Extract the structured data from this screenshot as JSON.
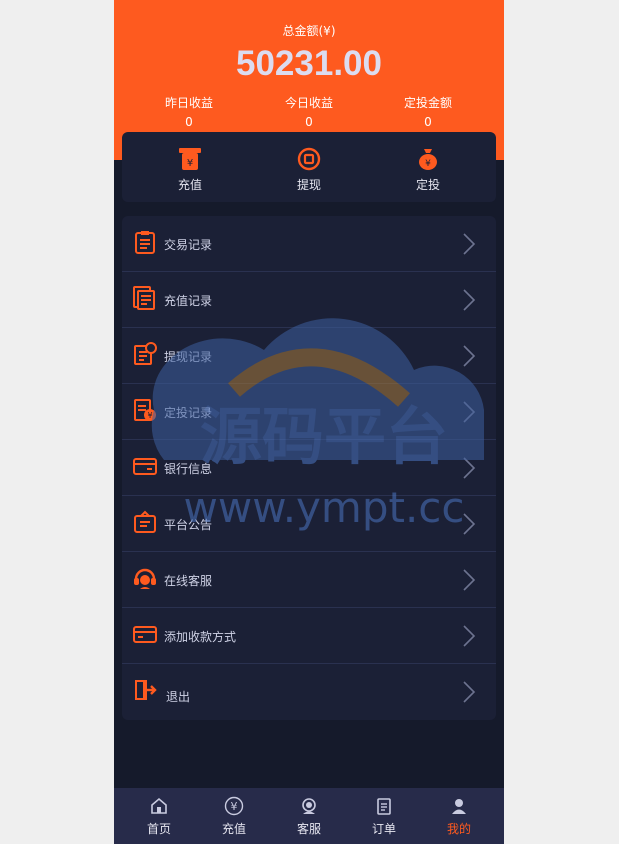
{
  "header": {
    "total_label": "总金额(¥)",
    "total_value": "50231.00",
    "stats": [
      {
        "label": "昨日收益",
        "value": "0"
      },
      {
        "label": "今日收益",
        "value": "0"
      },
      {
        "label": "定投金额",
        "value": "0"
      }
    ]
  },
  "actions": [
    {
      "label": "充值",
      "icon": "recharge-icon"
    },
    {
      "label": "提现",
      "icon": "withdraw-icon"
    },
    {
      "label": "定投",
      "icon": "moneybag-icon"
    }
  ],
  "menu": [
    {
      "label": "交易记录",
      "icon": "clipboard-icon"
    },
    {
      "label": "充值记录",
      "icon": "document-list-icon"
    },
    {
      "label": "提现记录",
      "icon": "withdraw-record-icon"
    },
    {
      "label": "定投记录",
      "icon": "invest-record-icon"
    },
    {
      "label": "银行信息",
      "icon": "bank-card-icon"
    },
    {
      "label": "平台公告",
      "icon": "announcement-icon"
    },
    {
      "label": "在线客服",
      "icon": "headset-icon"
    },
    {
      "label": "添加收款方式",
      "icon": "card-add-icon"
    },
    {
      "label": "退出",
      "icon": "logout-icon"
    }
  ],
  "watermark": {
    "title": "源码平台",
    "url": "www.ympt.cc"
  },
  "tabs": [
    {
      "label": "首页",
      "icon": "home-icon"
    },
    {
      "label": "充值",
      "icon": "yen-circle-icon"
    },
    {
      "label": "客服",
      "icon": "support-icon"
    },
    {
      "label": "订单",
      "icon": "order-icon"
    },
    {
      "label": "我的",
      "icon": "user-icon",
      "active": true
    }
  ],
  "colors": {
    "accent": "#fe5a1f",
    "background": "#151a2b",
    "card": "#1b2036",
    "tabbar": "#272b4a"
  }
}
